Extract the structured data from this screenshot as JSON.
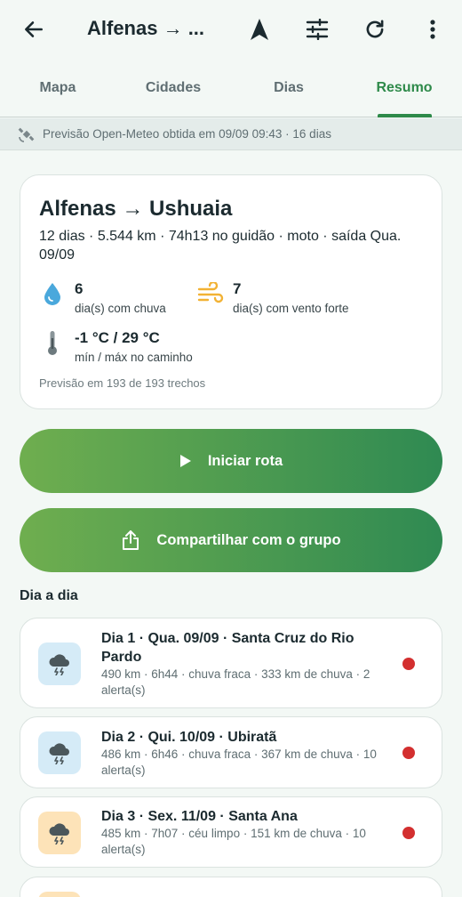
{
  "appbar": {
    "title": "Alfenas → ...",
    "icons": [
      "arrow-back-icon",
      "navigation-arrow-icon",
      "sliders-icon",
      "refresh-icon",
      "more-vert-icon"
    ]
  },
  "tabs": [
    {
      "label": "Mapa",
      "active": false
    },
    {
      "label": "Cidades",
      "active": false
    },
    {
      "label": "Dias",
      "active": false
    },
    {
      "label": "Resumo",
      "active": true
    }
  ],
  "info": {
    "text": "Previsão Open-Meteo obtida em 09/09 09:43 · 16 dias",
    "icon": "satellite-icon"
  },
  "summary": {
    "title": "Alfenas → Ushuaia",
    "subtitle": "12 dias · 5.544 km · 74h13 no guidão · moto · saída Qua. 09/09",
    "rain_value": "6",
    "rain_label": "dia(s) com chuva",
    "wind_value": "7",
    "wind_label": "dia(s) com vento forte",
    "temp_value": "-1 °C / 29 °C",
    "temp_label": "mín / máx no caminho",
    "footnote": "Previsão em 193 de 193 trechos"
  },
  "buttons": {
    "start": "Iniciar rota",
    "share": "Compartilhar com o grupo"
  },
  "section": {
    "title": "Dia a dia"
  },
  "days": [
    {
      "title": "Dia 1 · Qua. 09/09 · Santa Cruz do Rio Pardo",
      "meta": "490 km · 6h44 · chuva fraca · 333 km de chuva · 2 alerta(s)",
      "icon": "storm-cloud-icon",
      "bg": "#d5ebf7"
    },
    {
      "title": "Dia 2 · Qui. 10/09 · Ubiratã",
      "meta": "486 km · 6h46 · chuva fraca · 367 km de chuva · 10 alerta(s)",
      "icon": "storm-cloud-icon",
      "bg": "#d5ebf7"
    },
    {
      "title": "Dia 3 · Sex. 11/09 · Santa Ana",
      "meta": "485 km · 7h07 · céu limpo · 151 km de chuva · 10 alerta(s)",
      "icon": "storm-cloud-icon",
      "bg": "#fde3b8"
    }
  ],
  "colors": {
    "accent": "#2e8a4a",
    "alert": "#d32f2f",
    "rain": "#4aa8dc",
    "wind": "#f2b234"
  }
}
